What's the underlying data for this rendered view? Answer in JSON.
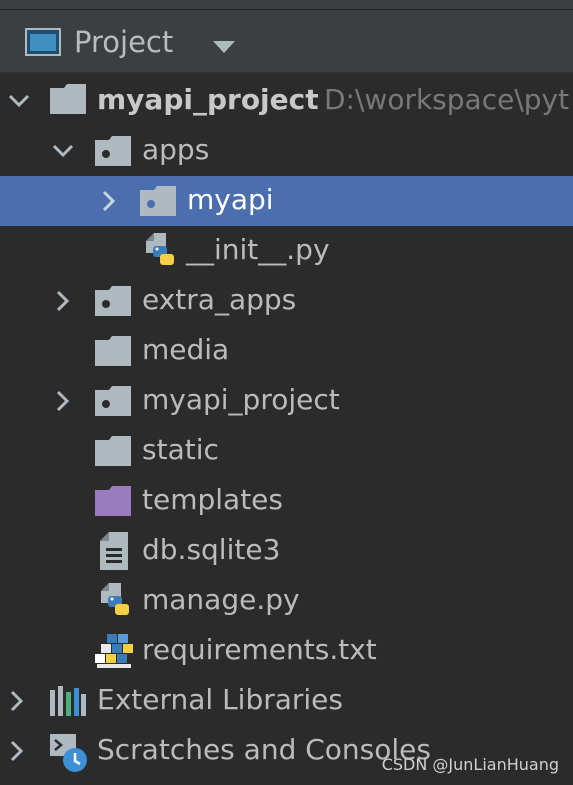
{
  "panel": {
    "title": "Project"
  },
  "tree": {
    "root": {
      "label": "myapi_project",
      "path": "D:\\workspace\\pyt"
    },
    "apps": {
      "label": "apps"
    },
    "myapi": {
      "label": "myapi"
    },
    "init": {
      "label": "__init__.py"
    },
    "extra_apps": {
      "label": "extra_apps"
    },
    "media": {
      "label": "media"
    },
    "myapi_project": {
      "label": "myapi_project"
    },
    "static": {
      "label": "static"
    },
    "templates": {
      "label": "templates"
    },
    "db": {
      "label": "db.sqlite3"
    },
    "manage": {
      "label": "manage.py"
    },
    "requirements": {
      "label": "requirements.txt"
    },
    "external_libraries": {
      "label": "External Libraries"
    },
    "scratches": {
      "label": "Scratches and Consoles"
    }
  },
  "watermark": "CSDN @JunLianHuang",
  "colors": {
    "background": "#2b2b2b",
    "header": "#3c3f41",
    "selection": "#4b6eaf",
    "folder": "#aeb9c0",
    "templates_folder": "#9a7bbf",
    "python_blue": "#3d7ab8",
    "python_yellow": "#f7cf45"
  },
  "icons": [
    "project-window-icon",
    "dropdown-arrow-icon",
    "chevron-down-icon",
    "chevron-right-icon",
    "folder-icon",
    "module-folder-icon",
    "python-file-icon",
    "text-file-icon",
    "requirements-file-icon",
    "libraries-icon",
    "scratches-icon"
  ]
}
